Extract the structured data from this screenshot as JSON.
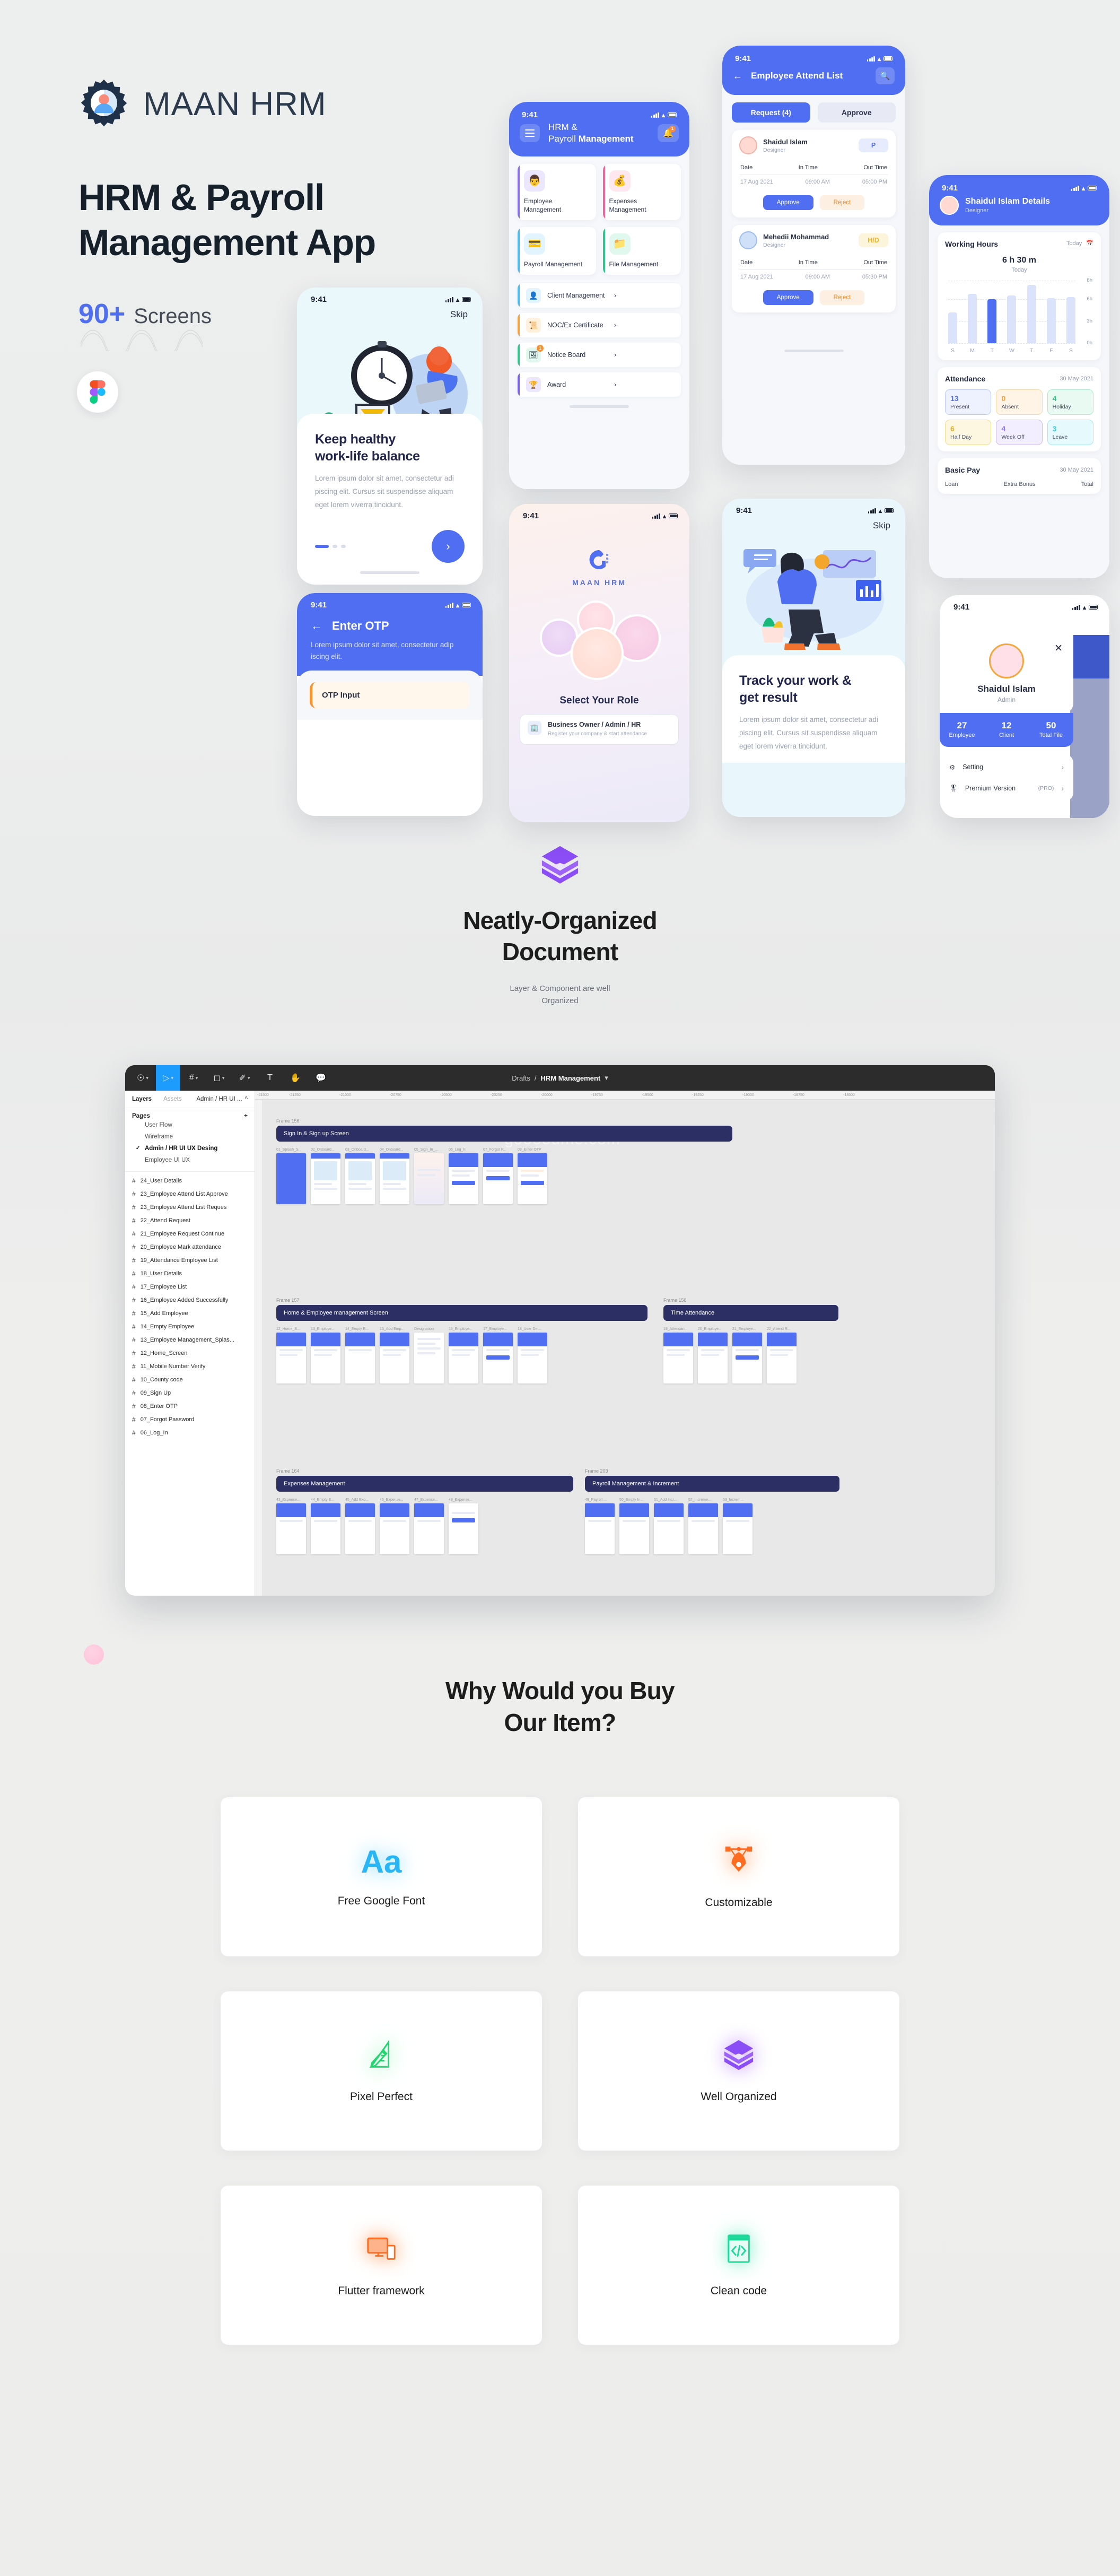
{
  "hero": {
    "brand": "MAAN HRM",
    "title_line1": "HRM & Payroll",
    "title_line2": "Management App",
    "screens_count": "90+",
    "screens_label": "Screens",
    "figma_icon": "figma-icon"
  },
  "phones": {
    "onboard1": {
      "time": "9:41",
      "skip": "Skip",
      "heading_line1": "Keep healthy",
      "heading_line2": "work-life balance",
      "body": "Lorem ipsum dolor sit amet, consectetur adi piscing elit. Cursus sit suspendisse aliquam eget lorem viverra tincidunt.",
      "next_icon": "chevron-right-icon"
    },
    "otp": {
      "time": "9:41",
      "title": "Enter OTP",
      "subtitle": "Lorem ipsum dolor sit amet, consectetur adip iscing elit.",
      "input_label": "OTP Input",
      "back_icon": "arrow-left-icon"
    },
    "home": {
      "time": "9:41",
      "title_line1": "HRM &",
      "title_line2_light": "Payroll ",
      "title_line2_bold": "Management",
      "menu_icon": "hamburger-icon",
      "bell_icon": "bell-icon",
      "bell_badge": "1",
      "cards": [
        {
          "label": "Employee\nManagement",
          "accent": "#8b6ef0",
          "tile": "#ece6ff",
          "glyph": "👨‍💼"
        },
        {
          "label": "Expenses\nManagement",
          "accent": "#f0669a",
          "tile": "#ffe7f0",
          "glyph": "💰"
        },
        {
          "label": "Payroll\nManagement",
          "accent": "#49bdf0",
          "tile": "#e2f4ff",
          "glyph": "💳"
        },
        {
          "label": "File\nManagement",
          "accent": "#2fc78a",
          "tile": "#e1f8ee",
          "glyph": "📁"
        }
      ],
      "rows": [
        {
          "label": "Client Management",
          "accent": "#49bdf0",
          "tile": "#e2f4ff",
          "glyph": "👤",
          "badge": ""
        },
        {
          "label": "NOC/Ex Certificate",
          "accent": "#f5a03d",
          "tile": "#fff1dd",
          "glyph": "📜",
          "badge": ""
        },
        {
          "label": "Notice Board",
          "accent": "#2fc78a",
          "tile": "#e1f8ee",
          "glyph": "🖼",
          "badge": "1"
        },
        {
          "label": "Award",
          "accent": "#7c5ff0",
          "tile": "#ece6ff",
          "glyph": "🏆",
          "badge": ""
        }
      ]
    },
    "role": {
      "time": "9:41",
      "logo_name": "MAAN HRM",
      "heading": "Select Your Role",
      "option_title": "Business Owner / Admin / HR",
      "option_desc": "Register your company & start attendance"
    },
    "attend": {
      "time": "9:41",
      "title": "Employee Attend List",
      "back_icon": "arrow-left-icon",
      "search_icon": "search-icon",
      "tabs": [
        {
          "label": "Request (4)",
          "active": true
        },
        {
          "label": "Approve",
          "active": false
        }
      ],
      "col_headers": [
        "Date",
        "In Time",
        "Out Time"
      ],
      "entries": [
        {
          "name": "Shaidul Islam",
          "role": "Designer",
          "status": "P",
          "status_color": "#4f6ef2",
          "status_bg": "#e6ebfd",
          "date": "17 Aug 2021",
          "in_time": "09:00 AM",
          "out_time": "05:00 PM",
          "approve": "Approve",
          "reject": "Reject"
        },
        {
          "name": "Mehedii Mohammad",
          "role": "Designer",
          "status": "H/D",
          "status_color": "#e8b426",
          "status_bg": "#fdf4dc",
          "date": "17 Aug 2021",
          "in_time": "09:00 AM",
          "out_time": "05:30 PM",
          "approve": "Approve",
          "reject": "Reject"
        }
      ]
    },
    "onboard2": {
      "time": "9:41",
      "skip": "Skip",
      "heading_line1": "Track your work &",
      "heading_line2": "get result",
      "body": "Lorem ipsum dolor sit amet, consectetur adi piscing elit. Cursus sit suspendisse aliquam eget lorem viverra tincidunt."
    },
    "details": {
      "time": "9:41",
      "name": "Shaidul Islam Details",
      "role": "Designer",
      "working_hours_title": "Working Hours",
      "working_hours_range": "Today",
      "calendar_icon": "calendar-icon",
      "total_hours": "6 h 30 m",
      "total_hours_sub": "Today",
      "attendance_title": "Attendance",
      "attendance_date": "30 May 2021",
      "attendance": [
        {
          "value": "13",
          "label": "Present",
          "color": "#4f6ef2",
          "bg": "#eef2fe",
          "border": "#bcccfa"
        },
        {
          "value": "0",
          "label": "Absent",
          "color": "#f5a03d",
          "bg": "#fff4e6",
          "border": "#fbd7a4"
        },
        {
          "value": "4",
          "label": "Holiday",
          "color": "#2fc78a",
          "bg": "#e9faf2",
          "border": "#a9ecce"
        },
        {
          "value": "6",
          "label": "Half Day",
          "color": "#e8b426",
          "bg": "#fdf7e2",
          "border": "#f2dc94"
        },
        {
          "value": "4",
          "label": "Week Off",
          "color": "#8b6ef0",
          "bg": "#f2eeff",
          "border": "#cbbcf8"
        },
        {
          "value": "3",
          "label": "Leave",
          "color": "#3ec8e0",
          "bg": "#e6f9fd",
          "border": "#a7e7f3"
        }
      ],
      "basic_pay_title": "Basic Pay",
      "basic_pay_date": "30 May 2021",
      "basic_pay_cols": [
        "Loan",
        "Extra Bonus",
        "Total"
      ]
    },
    "profile": {
      "time": "9:41",
      "close_icon": "close-icon",
      "name": "Shaidul Islam",
      "role": "Admin",
      "stats": [
        {
          "value": "27",
          "label": "Employee"
        },
        {
          "value": "12",
          "label": "Client"
        },
        {
          "value": "50",
          "label": "Total File"
        }
      ],
      "menu": [
        {
          "label": "Setting",
          "icon": "gear-icon",
          "tag": ""
        },
        {
          "label": "Premium Version",
          "icon": "medal-icon",
          "tag": "(PRO)"
        }
      ]
    }
  },
  "organized": {
    "icon": "layers-icon",
    "heading_line1": "Neatly-Organized",
    "heading_line2": "Document",
    "sub_line1": "Layer & Component are well",
    "sub_line2": "Organized"
  },
  "figma": {
    "breadcrumb_parent": "Drafts",
    "breadcrumb_sep": "/",
    "breadcrumb_file": "HRM Management",
    "tools": [
      {
        "name": "figma-menu-icon",
        "glyph": "⌘",
        "caret": true,
        "active": false
      },
      {
        "name": "move-tool-icon",
        "glyph": "▷",
        "caret": true,
        "active": true
      },
      {
        "name": "frame-tool-icon",
        "glyph": "#",
        "caret": true,
        "active": false
      },
      {
        "name": "shape-tool-icon",
        "glyph": "▭",
        "caret": true,
        "active": false
      },
      {
        "name": "pen-tool-icon",
        "glyph": "✒",
        "caret": true,
        "active": false
      },
      {
        "name": "text-tool-icon",
        "glyph": "T",
        "caret": false,
        "active": false
      },
      {
        "name": "hand-tool-icon",
        "glyph": "✋",
        "caret": false,
        "active": false
      },
      {
        "name": "comment-tool-icon",
        "glyph": "💬",
        "caret": false,
        "active": false
      }
    ],
    "panel_tabs": {
      "layers": "Layers",
      "assets": "Assets",
      "file": "Admin / HR UI ..."
    },
    "pages_label": "Pages",
    "pages": [
      {
        "label": "User Flow",
        "selected": false
      },
      {
        "label": "Wireframe",
        "selected": false
      },
      {
        "label": "Admin / HR UI UX Desing",
        "selected": true
      },
      {
        "label": "Employee UI UX",
        "selected": false
      }
    ],
    "layers": [
      "24_User Details",
      "23_Employee Attend List Approve",
      "23_Employee Attend List Reques",
      "22_Attend Request",
      "21_Employee Request Continue",
      "20_Employee Mark attendance",
      "19_Attendance Employee List",
      "18_User Details",
      "17_Employee List",
      "16_Employee Added Successfully",
      "15_Add Employee",
      "14_Empty Employee",
      "13_Employee Management_Splas...",
      "12_Home_Screen",
      "11_Mobile Number Verify",
      "10_County code",
      "09_Sign Up",
      "08_Enter OTP",
      "07_Forgot Password",
      "06_Log_In"
    ],
    "ruler_marks": [
      "-21500",
      "-21250",
      "-21000",
      "-20750",
      "-20500",
      "-20250",
      "-20000",
      "-19750",
      "-19500",
      "-19250",
      "-19000",
      "-18750",
      "-18500"
    ],
    "watermark": "goooodme.com",
    "frames": [
      {
        "frame_label": "Frame 156",
        "banner": "Sign In & Sign up Screen",
        "thumbs": [
          "01_Splash_S...",
          "02_Onboard...",
          "03_Onboard...",
          "04_Onboard...",
          "05_Sign_In_...",
          "06_Log_In",
          "07_Forgot P...",
          "08_Enter OTP"
        ]
      },
      {
        "frame_label": "Frame 157",
        "banner": "Home & Employee management Screen",
        "thumbs": [
          "12_Home_S...",
          "13_Employe...",
          "14_Empty E...",
          "15_Add Emp...",
          "Designation",
          "16_Employe...",
          "17_Employe...",
          "18_User Det..."
        ]
      },
      {
        "frame_label": "Frame 158",
        "banner": "Time Attendance",
        "thumbs": [
          "19_Attendan...",
          "20_Employe...",
          "21_Employe...",
          "22_Attend R..."
        ]
      },
      {
        "frame_label": "Frame 164",
        "banner": "Expenses Management",
        "thumbs": [
          "43_Expense...",
          "44_Empty E...",
          "45_Add Exp...",
          "46_Expense...",
          "47_Expense...",
          "48_Expense..."
        ]
      },
      {
        "frame_label": "Frame 203",
        "banner": "Payroll Management & Increment",
        "thumbs": [
          "49_Payroll ...",
          "50_Empty In...",
          "51_Add Incr...",
          "52_Increme...",
          "53_Increm..."
        ]
      }
    ]
  },
  "why": {
    "heading_line1": "Why Would you Buy",
    "heading_line2": "Our Item?",
    "features": [
      {
        "label": "Free Google Font",
        "icon": "font-aa-icon",
        "color": "#29b6f6"
      },
      {
        "label": "Customizable",
        "icon": "pen-node-icon",
        "color": "#ff6b1f"
      },
      {
        "label": "Pixel Perfect",
        "icon": "ruler-pencil-icon",
        "color": "#22d66f"
      },
      {
        "label": "Well Organized",
        "icon": "layers-icon",
        "color": "#8b4df5"
      },
      {
        "label": "Flutter framework",
        "icon": "devices-icon",
        "color": "#ff6b1f"
      },
      {
        "label": "Clean code",
        "icon": "code-icon",
        "color": "#1fd99a"
      }
    ]
  },
  "chart_data": {
    "type": "bar",
    "title": "Working Hours",
    "subtitle": "6 h 30 m Today",
    "categories": [
      "S",
      "M",
      "T",
      "W",
      "T",
      "F",
      "S"
    ],
    "values": [
      4.2,
      6.8,
      6.0,
      6.5,
      8.0,
      6.2,
      6.4
    ],
    "highlight_index": 2,
    "ylabel": "",
    "xlabel": "",
    "ytick_labels": [
      "0h",
      "3h",
      "6h",
      "8h"
    ],
    "ytick_values": [
      0,
      3,
      6,
      8
    ],
    "ylim": [
      0,
      8.6
    ],
    "grid": true,
    "legend": "none",
    "bar_color": "#dbe3fb",
    "highlight_color": "#4f6ef2"
  }
}
